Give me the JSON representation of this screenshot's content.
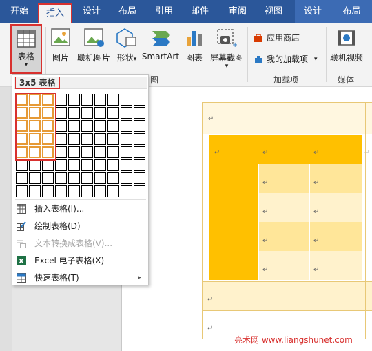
{
  "tabs": [
    {
      "label": "开始"
    },
    {
      "label": "插入"
    },
    {
      "label": "设计"
    },
    {
      "label": "布局"
    },
    {
      "label": "引用"
    },
    {
      "label": "邮件"
    },
    {
      "label": "审阅"
    },
    {
      "label": "视图"
    },
    {
      "label": "设计"
    },
    {
      "label": "布局"
    }
  ],
  "ribbon": {
    "table_btn": {
      "label": "表格",
      "arrow": "▾"
    },
    "picture": {
      "label": "图片"
    },
    "online_picture": {
      "label": "联机图片"
    },
    "shapes": {
      "label": "形状",
      "arrow": "▾"
    },
    "smartart": {
      "label": "SmartArt"
    },
    "chart": {
      "label": "图表"
    },
    "screenshot": {
      "label": "屏幕截图",
      "arrow": "▾"
    },
    "app_store": {
      "label": "应用商店"
    },
    "my_addins": {
      "label": "我的加载项",
      "arrow": "▾"
    },
    "online_video": {
      "label": "联机视频"
    },
    "group_illustrations": "图",
    "group_addins": "加载项",
    "group_media": "媒体"
  },
  "dropdown": {
    "title": "3x5 表格",
    "grid_cols": 10,
    "grid_rows": 8,
    "selected_cols": 3,
    "selected_rows": 5,
    "items": [
      {
        "label": "插入表格(I)...",
        "icon": "insert-table-icon",
        "disabled": false
      },
      {
        "label": "绘制表格(D)",
        "icon": "draw-table-icon",
        "disabled": false
      },
      {
        "label": "文本转换成表格(V)...",
        "icon": "text-to-table-icon",
        "disabled": true
      },
      {
        "label": "Excel 电子表格(X)",
        "icon": "excel-icon",
        "disabled": false
      },
      {
        "label": "快速表格(T)",
        "icon": "quick-table-icon",
        "disabled": false,
        "submenu": "▸"
      }
    ]
  },
  "document": {
    "para_mark": "↵"
  },
  "watermark": "亮术网 www.liangshunet.com",
  "colors": {
    "tab_bar": "#2b579a",
    "accent_red": "#d8312f",
    "header_cell": "#ffc000",
    "band_light": "#fff2cc",
    "band_mid": "#ffe699"
  }
}
